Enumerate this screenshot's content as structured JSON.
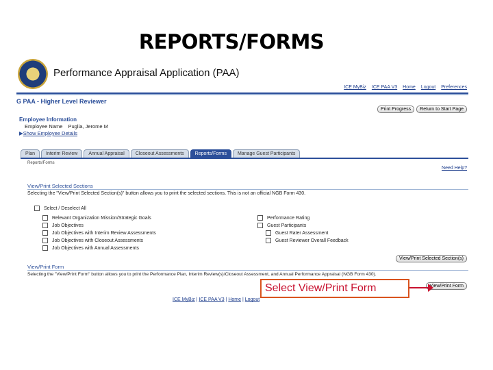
{
  "slide_title": "REPORTS/FORMS",
  "app": {
    "title": "Performance Appraisal Application (PAA)",
    "logo_icon": "national-guard-seal-icon"
  },
  "top_links": [
    "ICE MyBiz",
    "ICE PAA V3",
    "Home",
    "Logout",
    "Preferences"
  ],
  "section_title": "G PAA - Higher Level Reviewer",
  "top_buttons": [
    "Print Progress",
    "Return to Start Page"
  ],
  "employee": {
    "heading": "Employee Information",
    "name_label": "Employee Name",
    "name_value": "Puglia, Jerome M",
    "details_link": "Show Employee Details"
  },
  "tabs": [
    "Plan",
    "Interim Review",
    "Annual Appraisal",
    "Closeout Assessments",
    "Reports/Forms",
    "Manage Guest Participants"
  ],
  "active_tab": "Reports/Forms",
  "breadcrumb": "Reports/Forms",
  "help_link": "Need Help?",
  "view_print_sections": {
    "title": "View/Print Selected Sections",
    "description": "Selecting the \"View/Print Selected Section(s)\" button allows you to print the selected sections. This is not an official NGB Form 430.",
    "select_all": "Select / Deselect All",
    "left_options": [
      "Relevant Organization Mission/Strategic Goals",
      "Job Objectives",
      "Job Objectives with Interim Review Assessments",
      "Job Objectives with Closeout Assessments",
      "Job Objectives with Annual Assessments"
    ],
    "right_options": [
      "Performance Rating",
      "Guest Participants"
    ],
    "right_sub_options": [
      "Guest Rater Assessment",
      "Guest Reviewer Overall Feedback"
    ],
    "button": "View/Print Selected Section(s)"
  },
  "view_print_form": {
    "title": "View/Print Form",
    "description": "Selecting the \"View/Print Form\" button allows you to print the Performance Plan, Interim Review(s)/Closeout Assessment, and Annual Performance Appraisal (NGB Form 430).",
    "button": "View/Print Form"
  },
  "annotation": "Select View/Print Form",
  "footer_links": [
    "ICE MyBiz",
    "ICE PAA V3",
    "Home",
    "Logout"
  ],
  "colors": {
    "brand_blue": "#2c4f9a",
    "annotation_red": "#c8102e",
    "annotation_border": "#d9531e"
  }
}
